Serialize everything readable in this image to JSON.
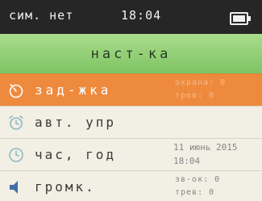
{
  "status": {
    "sim": "сим. нет",
    "time": "18:04",
    "battery_icon": "battery-full-icon"
  },
  "header": {
    "title": "наст-ка"
  },
  "menu": [
    {
      "id": "alarm",
      "label": "зад-жка",
      "icon": "stopwatch-icon",
      "selected": true,
      "values": [
        "охрана: 0",
        "трев:    0"
      ]
    },
    {
      "id": "auto",
      "label": "авт. упр",
      "icon": "alarm-clock-icon",
      "selected": false,
      "values": []
    },
    {
      "id": "datetime",
      "label": "час, год",
      "icon": "clock-icon",
      "selected": false,
      "values": [
        "11 июнь 2015",
        "18:04"
      ]
    },
    {
      "id": "volume",
      "label": "громк.",
      "icon": "speaker-icon",
      "selected": false,
      "values": [
        "зв-ок:   0",
        "трев:    0"
      ]
    }
  ],
  "colors": {
    "status_bar": "#262626",
    "header": "#8fd070",
    "selected_row": "#ee8a3e",
    "background": "#f2efe4"
  }
}
